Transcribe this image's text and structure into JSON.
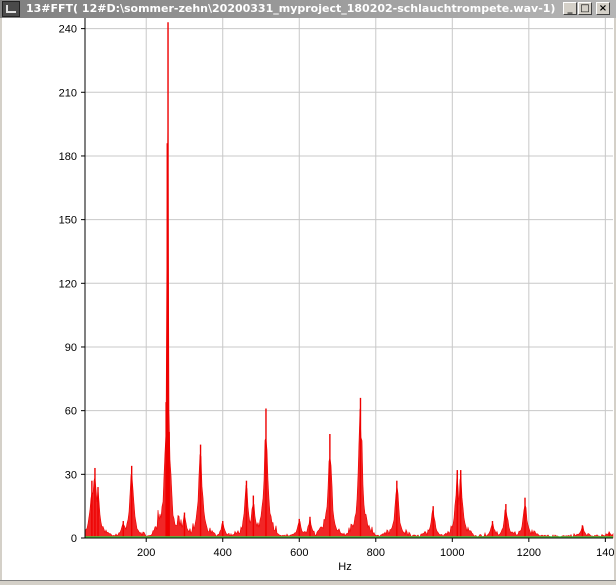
{
  "window": {
    "title": "13#FFT( 12#D:\\sommer-zehn\\20200331_myproject_180202-schlauchtrompete.wav-1)",
    "minimize_glyph": "_",
    "maximize_glyph": "□",
    "close_glyph": "×"
  },
  "chart_data": {
    "type": "line",
    "title": "",
    "xlabel": "Hz",
    "ylabel": "",
    "xlim": [
      40,
      1420
    ],
    "ylim": [
      0,
      245
    ],
    "x_ticks": [
      200,
      400,
      600,
      800,
      1000,
      1200,
      1400
    ],
    "x_tick_labels": [
      "200",
      "400",
      "600",
      "800",
      "1000",
      "1200",
      "140"
    ],
    "y_ticks": [
      0,
      30,
      60,
      90,
      120,
      150,
      180,
      210,
      240
    ],
    "y_tick_labels": [
      "0",
      "30",
      "60",
      "90",
      "120",
      "150",
      "180",
      "210",
      "240"
    ],
    "grid": true,
    "series_color": "#ee0000",
    "baseline_color": "#44cc44",
    "series": [
      {
        "peaks": [
          {
            "x": 58,
            "y": 27
          },
          {
            "x": 66,
            "y": 33
          },
          {
            "x": 74,
            "y": 24
          },
          {
            "x": 140,
            "y": 8
          },
          {
            "x": 162,
            "y": 34
          },
          {
            "x": 252,
            "y": 64
          },
          {
            "x": 255,
            "y": 186
          },
          {
            "x": 257,
            "y": 243
          },
          {
            "x": 260,
            "y": 50
          },
          {
            "x": 300,
            "y": 12
          },
          {
            "x": 342,
            "y": 44
          },
          {
            "x": 400,
            "y": 8
          },
          {
            "x": 462,
            "y": 27
          },
          {
            "x": 480,
            "y": 20
          },
          {
            "x": 513,
            "y": 61
          },
          {
            "x": 600,
            "y": 9
          },
          {
            "x": 628,
            "y": 10
          },
          {
            "x": 680,
            "y": 49
          },
          {
            "x": 760,
            "y": 66
          },
          {
            "x": 855,
            "y": 27
          },
          {
            "x": 950,
            "y": 15
          },
          {
            "x": 1013,
            "y": 32
          },
          {
            "x": 1022,
            "y": 32
          },
          {
            "x": 1105,
            "y": 8
          },
          {
            "x": 1140,
            "y": 16
          },
          {
            "x": 1190,
            "y": 19
          },
          {
            "x": 1340,
            "y": 6
          },
          {
            "x": 1410,
            "y": 3
          }
        ]
      }
    ]
  }
}
